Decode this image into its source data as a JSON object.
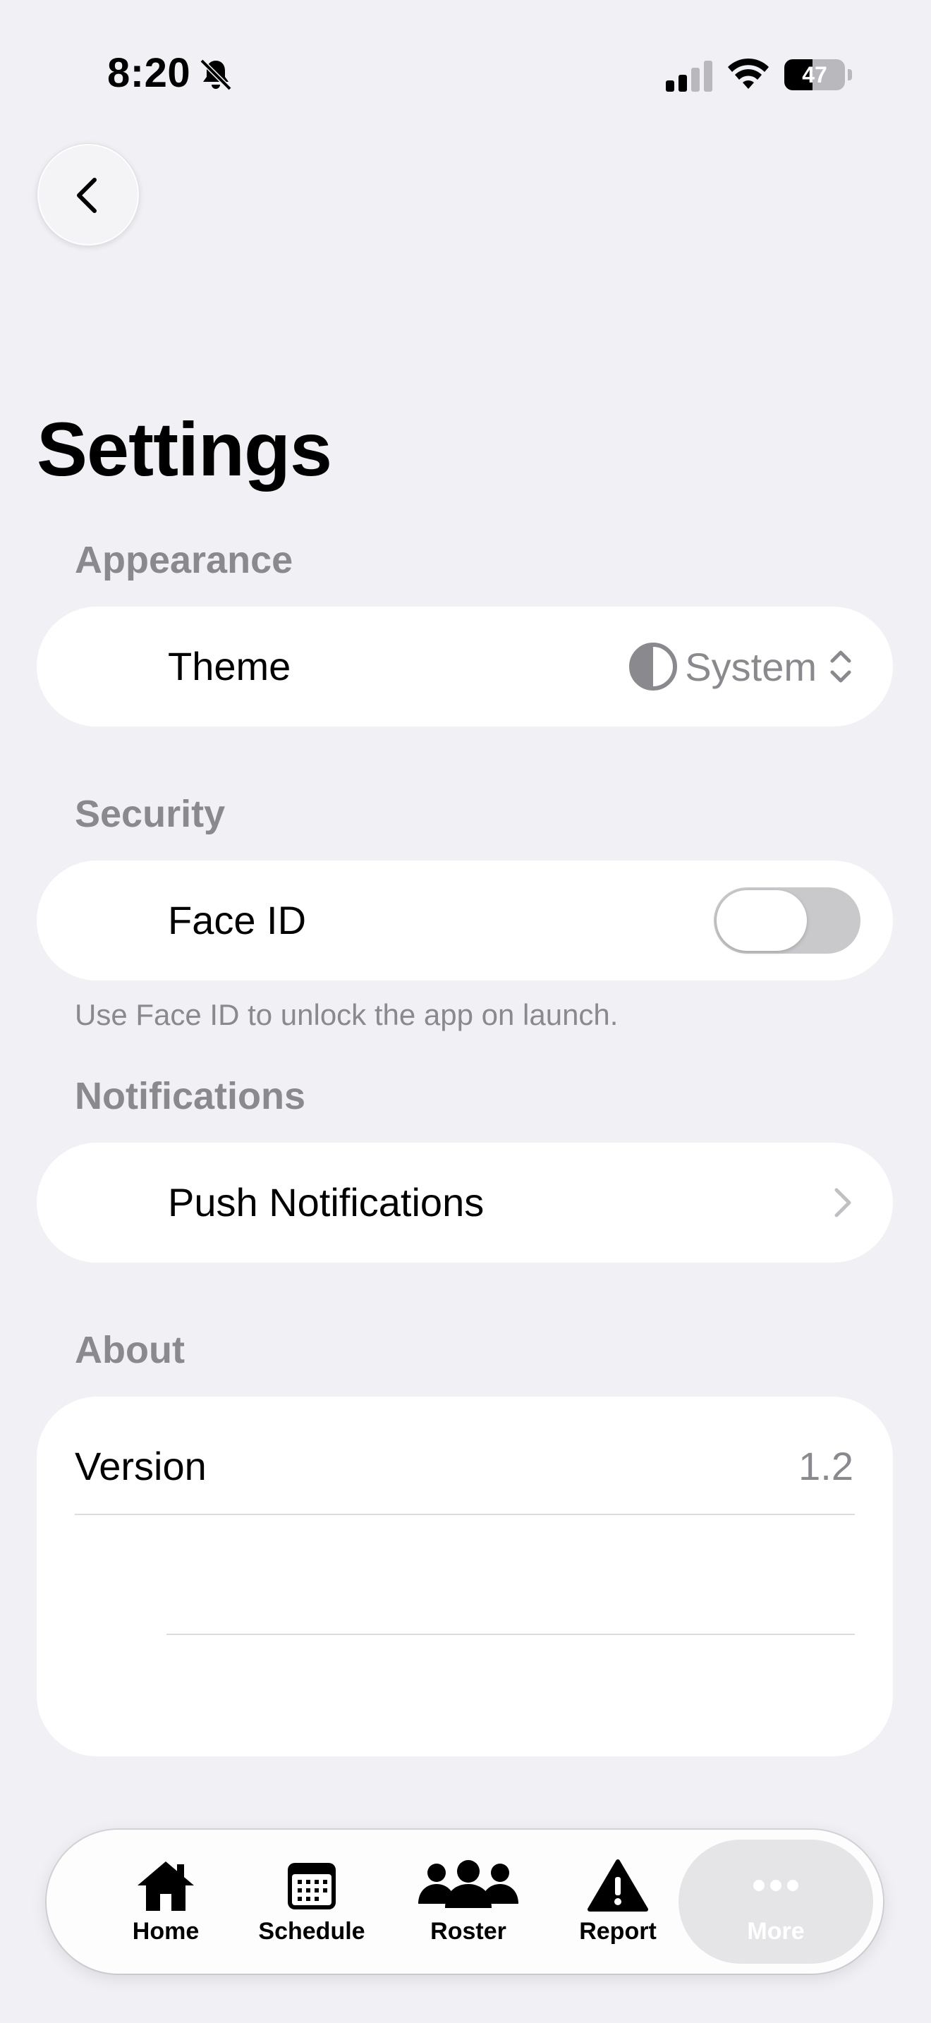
{
  "status_bar": {
    "time": "8:20",
    "battery_level": "47",
    "battery_fraction": 0.47
  },
  "header": {
    "back_icon": "chevron-left-icon",
    "title": "Settings"
  },
  "sections": {
    "appearance": {
      "header": "Appearance",
      "theme_label": "Theme",
      "theme_value": "System",
      "theme_icon": "contrast-icon"
    },
    "security": {
      "header": "Security",
      "face_id_label": "Face ID",
      "face_id_enabled": false,
      "footnote": "Use Face ID to unlock the app on launch."
    },
    "notifications": {
      "header": "Notifications",
      "push_label": "Push Notifications"
    },
    "about": {
      "header": "About",
      "version_label": "Version",
      "version_value": "1.2"
    }
  },
  "tab_bar": {
    "tabs": [
      {
        "label": "Home",
        "icon": "house-icon"
      },
      {
        "label": "Schedule",
        "icon": "calendar-icon"
      },
      {
        "label": "Roster",
        "icon": "people-icon"
      },
      {
        "label": "Report",
        "icon": "warning-icon"
      },
      {
        "label": "More",
        "icon": "ellipsis-icon",
        "selected": true
      }
    ]
  },
  "colors": {
    "background": "#f1f0f5",
    "card": "#ffffff",
    "secondary_text": "#8a8a8e",
    "toggle_off": "#c9c9cc"
  }
}
